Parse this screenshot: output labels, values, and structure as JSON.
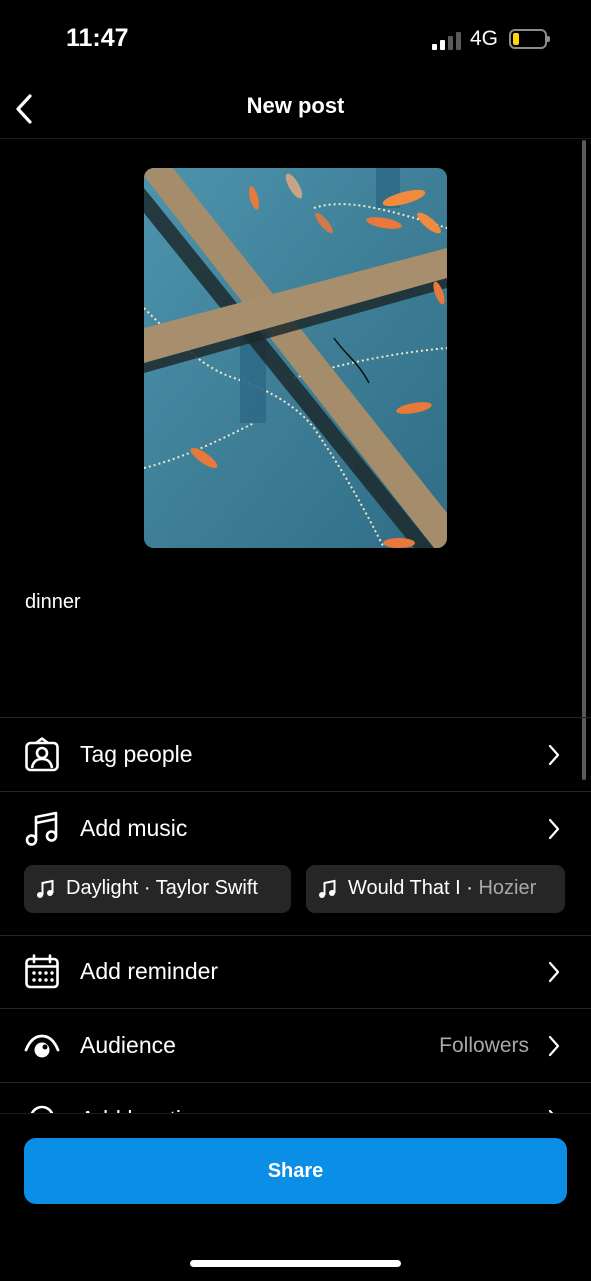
{
  "status_bar": {
    "time": "11:47",
    "network": "4G"
  },
  "header": {
    "title": "New post"
  },
  "caption": "dinner",
  "rows": {
    "tag_people": "Tag people",
    "add_music": "Add music",
    "add_reminder": "Add reminder",
    "audience": {
      "label": "Audience",
      "value": "Followers"
    },
    "add_location": "Add location"
  },
  "music_suggestions": [
    {
      "title": "Daylight",
      "sep": " · ",
      "artist": "Taylor Swift"
    },
    {
      "title": "Would That I",
      "sep": " · ",
      "artist": "Hozier"
    }
  ],
  "share_label": "Share",
  "colors": {
    "accent": "#0b8fe6",
    "background": "#000000",
    "chip": "#262626",
    "secondary_text": "#a8a8a8",
    "battery": "#ffd60a"
  }
}
